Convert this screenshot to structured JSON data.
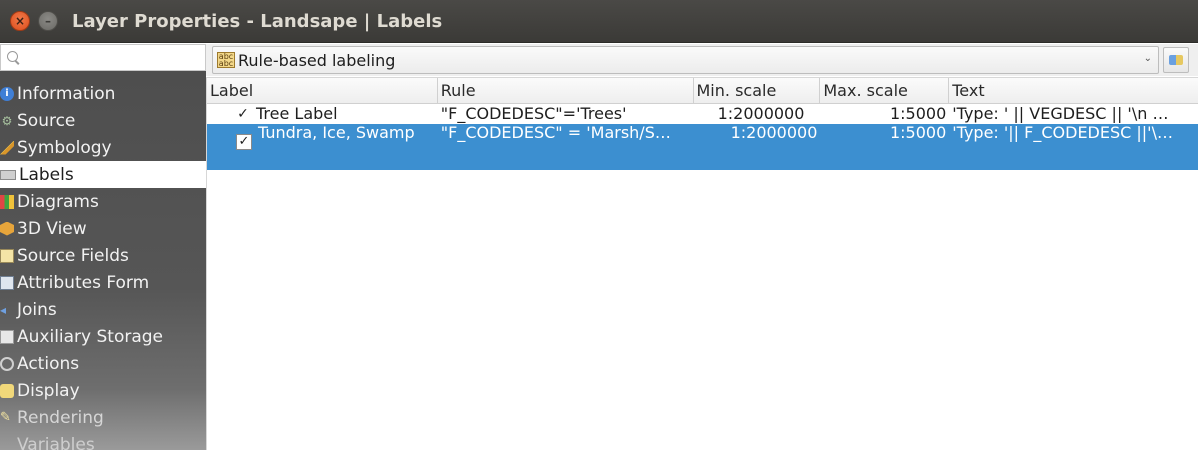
{
  "window": {
    "title": "Layer Properties - Landsape | Labels",
    "close_glyph": "×",
    "min_glyph": "–"
  },
  "sidebar": {
    "search_placeholder": "",
    "items": [
      {
        "label": "Information",
        "icon": "info-icon"
      },
      {
        "label": "Source",
        "icon": "source-icon"
      },
      {
        "label": "Symbology",
        "icon": "symbology-icon"
      },
      {
        "label": "Labels",
        "icon": "labels-icon",
        "selected": true
      },
      {
        "label": "Diagrams",
        "icon": "diagrams-icon"
      },
      {
        "label": "3D View",
        "icon": "cube-icon"
      },
      {
        "label": "Source Fields",
        "icon": "fields-icon"
      },
      {
        "label": "Attributes Form",
        "icon": "form-icon"
      },
      {
        "label": "Joins",
        "icon": "joins-icon"
      },
      {
        "label": "Auxiliary Storage",
        "icon": "storage-icon"
      },
      {
        "label": "Actions",
        "icon": "actions-icon"
      },
      {
        "label": "Display",
        "icon": "display-icon"
      },
      {
        "label": "Rendering",
        "icon": "rendering-icon"
      },
      {
        "label": "Variables",
        "icon": ""
      }
    ]
  },
  "labeling": {
    "mode": "Rule-based labeling",
    "mode_icon": "abc",
    "arrow": "⌄"
  },
  "table": {
    "headers": [
      "Label",
      "Rule",
      "Min. scale",
      "Max. scale",
      "Text"
    ],
    "rows": [
      {
        "checked": true,
        "label": "Tree Label",
        "rule": "\"F_CODEDESC\"='Trees'",
        "min_scale": "1:2000000",
        "max_scale": "1:5000",
        "text": "'Type: '  ||   VEGDESC  || '\\n …"
      },
      {
        "checked": true,
        "selected": true,
        "label": "Tundra, Ice, Swamp",
        "rule": "\"F_CODEDESC\" =  'Marsh/S…",
        "min_scale": "1:2000000",
        "max_scale": "1:5000",
        "text": "'Type: '|| F_CODEDESC ||'\\…"
      }
    ],
    "check_glyph": "✓"
  },
  "colors": {
    "titlebar": "#3f3e3b",
    "sidebar": "#555555",
    "selection": "#3c8fd0"
  }
}
